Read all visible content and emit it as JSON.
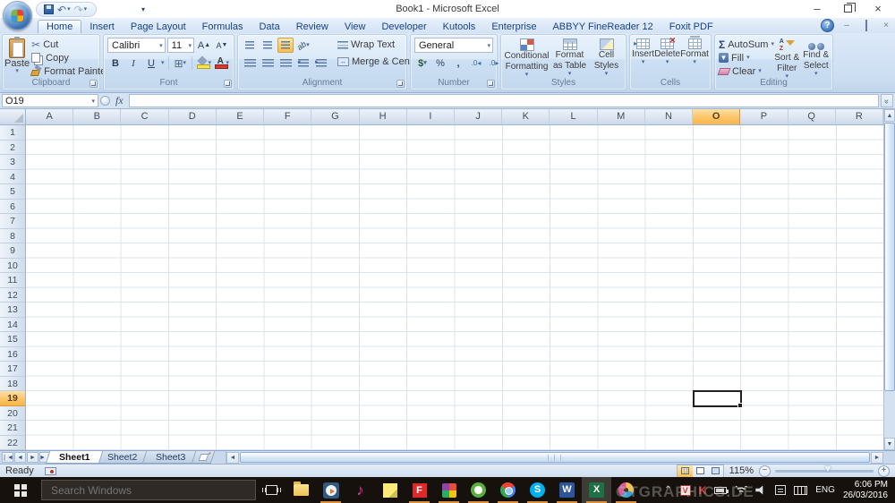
{
  "window": {
    "title": "Book1 - Microsoft Excel"
  },
  "ribbon": {
    "tabs": [
      {
        "label": "Home",
        "active": true
      },
      {
        "label": "Insert"
      },
      {
        "label": "Page Layout"
      },
      {
        "label": "Formulas"
      },
      {
        "label": "Data"
      },
      {
        "label": "Review"
      },
      {
        "label": "View"
      },
      {
        "label": "Developer"
      },
      {
        "label": "Kutools"
      },
      {
        "label": "Enterprise"
      },
      {
        "label": "ABBYY FineReader 12"
      },
      {
        "label": "Foxit PDF"
      }
    ],
    "clipboard": {
      "label": "Clipboard",
      "paste": "Paste",
      "cut": "Cut",
      "copy": "Copy",
      "format_painter": "Format Painter"
    },
    "font": {
      "label": "Font",
      "family": "Calibri",
      "size": "11",
      "bold": "B",
      "italic": "I",
      "underline": "U"
    },
    "alignment": {
      "label": "Alignment",
      "wrap_text": "Wrap Text",
      "merge_center": "Merge & Center"
    },
    "number": {
      "label": "Number",
      "format": "General",
      "currency": "$",
      "percent": "%",
      "comma": ","
    },
    "styles": {
      "label": "Styles",
      "conditional": "Conditional Formatting",
      "format_table": "Format as Table",
      "cell_styles": "Cell Styles"
    },
    "cells": {
      "label": "Cells",
      "insert": "Insert",
      "delete": "Delete",
      "format": "Format"
    },
    "editing": {
      "label": "Editing",
      "autosum": "AutoSum",
      "fill": "Fill",
      "clear": "Clear",
      "sort_filter": "Sort & Filter",
      "find_select": "Find & Select"
    }
  },
  "formula_bar": {
    "name_box": "O19",
    "fx_label": "fx",
    "formula": ""
  },
  "grid": {
    "columns": [
      "A",
      "B",
      "C",
      "D",
      "E",
      "F",
      "G",
      "H",
      "I",
      "J",
      "K",
      "L",
      "M",
      "N",
      "O",
      "P",
      "Q",
      "R"
    ],
    "rows": [
      "1",
      "2",
      "3",
      "4",
      "5",
      "6",
      "7",
      "8",
      "9",
      "10",
      "11",
      "12",
      "13",
      "14",
      "15",
      "16",
      "17",
      "18",
      "19",
      "20",
      "21",
      "22"
    ],
    "selected_column": "O",
    "selected_row": "19",
    "selected_cell": "O19"
  },
  "sheet_tabs": {
    "active": "Sheet1",
    "tabs": [
      "Sheet1",
      "Sheet2",
      "Sheet3"
    ]
  },
  "status_bar": {
    "mode": "Ready",
    "zoom_level": "115%"
  },
  "taskbar": {
    "search_placeholder": "Search Windows",
    "language": "ENG",
    "time": "6:06 PM",
    "date": "26/03/2016",
    "apps": [
      {
        "id": "file-explorer",
        "running": false
      },
      {
        "id": "media-player",
        "running": true
      },
      {
        "id": "music-app",
        "running": false
      },
      {
        "id": "sticky-notes",
        "running": false
      },
      {
        "id": "flipboard",
        "running": true
      },
      {
        "id": "photos",
        "running": true
      },
      {
        "id": "green-browser",
        "running": true
      },
      {
        "id": "chrome",
        "running": true
      },
      {
        "id": "skype",
        "running": true
      },
      {
        "id": "word",
        "running": true
      },
      {
        "id": "excel",
        "running": true,
        "active": true
      },
      {
        "id": "graphics-app",
        "running": true
      }
    ]
  },
  "watermark": "GTGRAPHICS.DE",
  "colors": {
    "selection_header": "#F9BD60",
    "running_underline": "#D8903C",
    "excel_green": "#1E7145",
    "tab_text": "#15428B"
  }
}
